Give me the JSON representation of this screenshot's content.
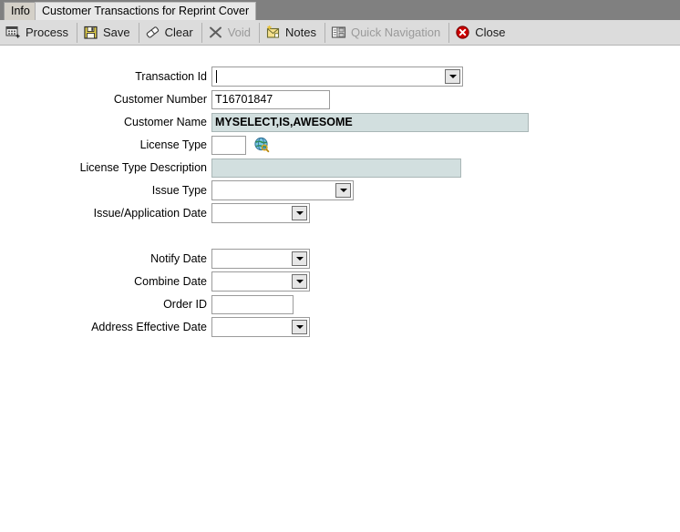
{
  "tabs": [
    {
      "label": "Info",
      "active": false
    },
    {
      "label": "Customer Transactions for Reprint Cover",
      "active": true
    }
  ],
  "toolbar": {
    "process_label": "Process",
    "save_label": "Save",
    "clear_label": "Clear",
    "void_label": "Void",
    "notes_label": "Notes",
    "quick_navigation_label": "Quick Navigation",
    "close_label": "Close",
    "icons": {
      "process": "process-icon",
      "save": "floppy-disk-icon",
      "clear": "eraser-icon",
      "void": "x-mark-icon",
      "notes": "notes-icon",
      "quick_navigation": "quick-navigation-icon",
      "close": "close-circle-icon"
    }
  },
  "form": {
    "transaction_id": {
      "label": "Transaction Id",
      "value": ""
    },
    "customer_number": {
      "label": "Customer Number",
      "value": "T16701847"
    },
    "customer_name": {
      "label": "Customer Name",
      "value": "MYSELECT,IS,AWESOME"
    },
    "license_type": {
      "label": "License Type",
      "value": "",
      "lookup_icon": "globe-search-icon"
    },
    "license_type_description": {
      "label": "License Type Description",
      "value": ""
    },
    "issue_type": {
      "label": "Issue Type",
      "value": ""
    },
    "issue_application_date": {
      "label": "Issue/Application Date",
      "value": ""
    },
    "notify_date": {
      "label": "Notify Date",
      "value": ""
    },
    "combine_date": {
      "label": "Combine Date",
      "value": ""
    },
    "order_id": {
      "label": "Order ID",
      "value": ""
    },
    "address_effective_date": {
      "label": "Address Effective Date",
      "value": ""
    }
  },
  "colors": {
    "toolbar_bg": "#dcdcdc",
    "tabstrip_bg": "#808080",
    "readonly_field_bg": "#d2dfdf",
    "close_red": "#cc0000",
    "notes_yellow": "#f5e08c"
  }
}
